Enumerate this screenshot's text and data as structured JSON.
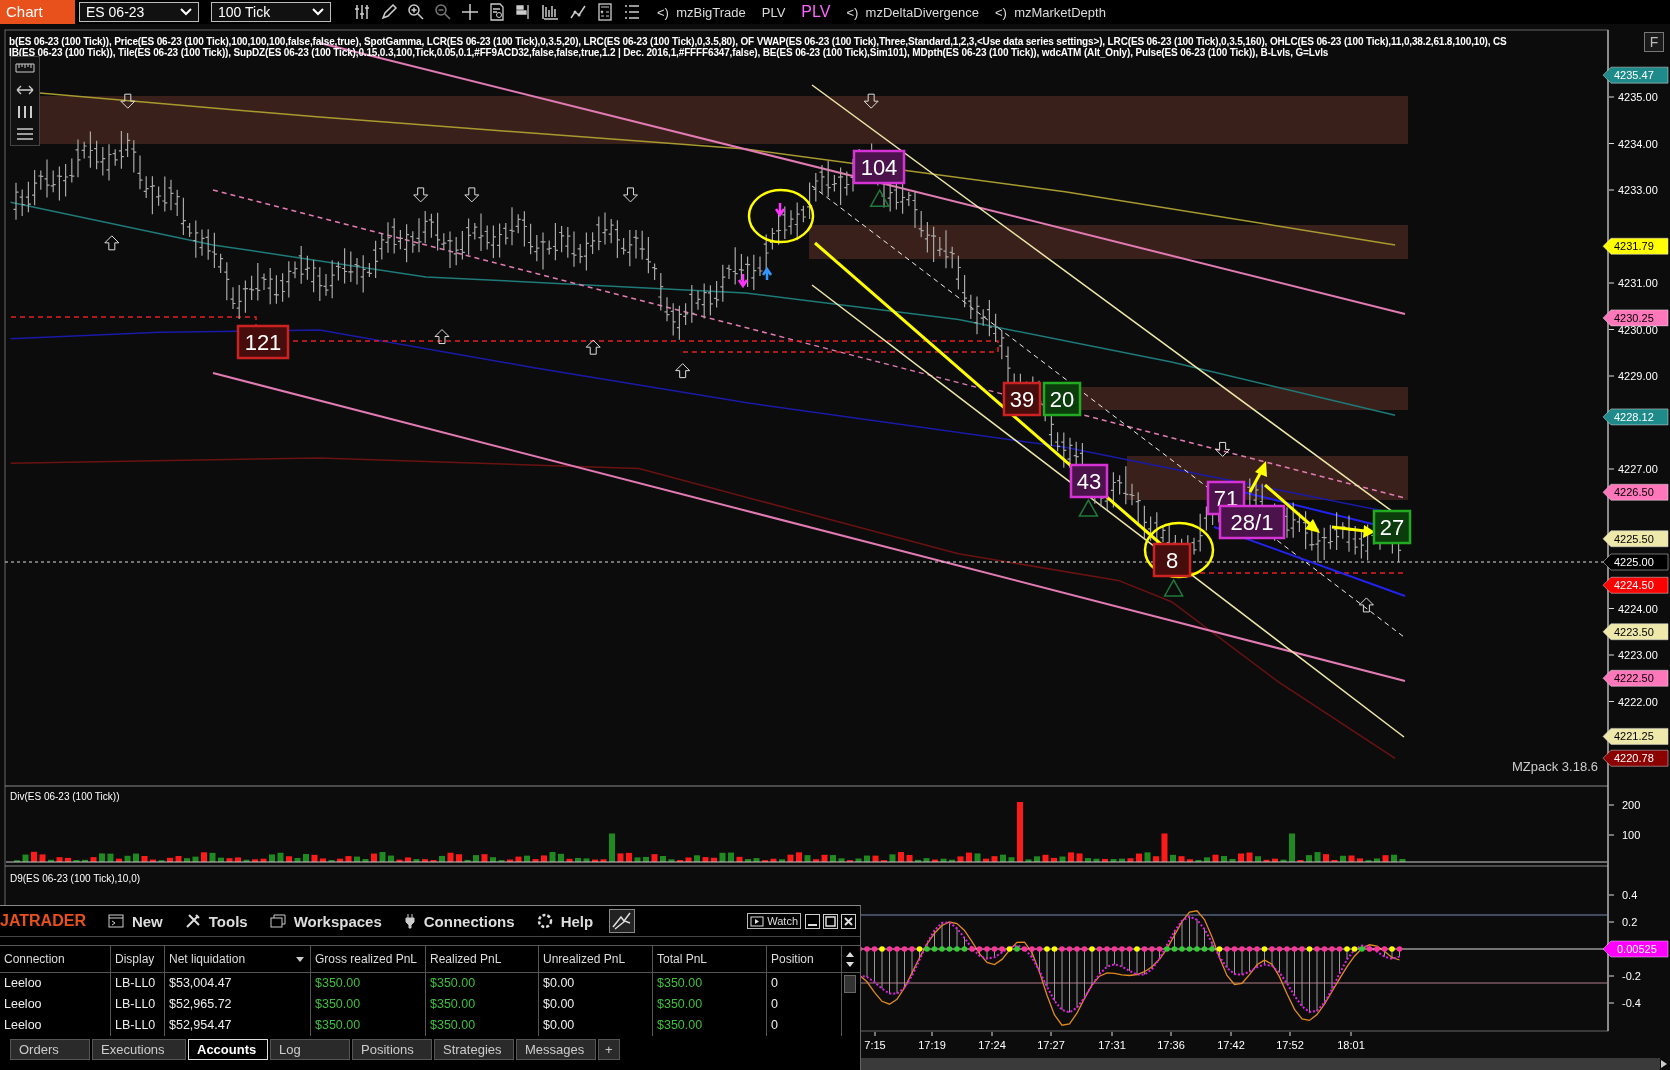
{
  "toolbar": {
    "tab": "Chart",
    "instrument": "ES 06-23",
    "interval": "100 Tick",
    "toggles": [
      {
        "label": "<)  mzBigTrade",
        "active": false
      },
      {
        "label": "PLV",
        "active": false
      },
      {
        "label": "PLV",
        "active": true
      },
      {
        "label": "<)  mzDeltaDivergence",
        "active": false
      },
      {
        "label": "<)  mzMarketDepth",
        "active": false
      }
    ]
  },
  "chart": {
    "legend": [
      "b(ES 06-23 (100 Tick)), Price(ES 06-23 (100 Tick),100,100,100,false,false,true), SpotGamma, LCR(ES 06-23 (100 Tick),0,3.5,20), LRC(ES 06-23 (100 Tick),0,3.5,80), OF VWAP(ES 06-23 (100 Tick),Three,Standard,1,2,3,<Use data series settings>), LRC(ES 06-23 (100 Tick),0,3.5,160), OHLC(ES 06-23 (100 Tick),11,0,38.2,61.8,100,10), CS",
      "IB(ES 06-23 (100 Tick)), Tile(ES 06-23 (100 Tick)), SupDZ(ES 06-23 (100 Tick),0.15,0.3,100,Tick,0.05,0.1,#FF9ACD32,false,false,true,1.2 | Dec. 2016,1,#FFFF6347,false), BE(ES 06-23 (100 Tick),Sim101), MDpth(ES 06-23 (100 Tick)), wdcATM (Alt_Only), Pulse(ES 06-23 (100 Tick)), B-Lvls, G=Lvls"
    ],
    "f_button": "F",
    "version": "MZpack 3.18.6",
    "box_labels": [
      {
        "text": "121",
        "color": "#cc2222"
      },
      {
        "text": "104",
        "color": "#d633d6"
      },
      {
        "text": "39",
        "color": "#cc2222"
      },
      {
        "text": "20",
        "color": "#22aa22"
      },
      {
        "text": "43",
        "color": "#d633d6"
      },
      {
        "text": "71",
        "color": "#d633d6"
      },
      {
        "text": "28/1",
        "color": "#d633d6"
      },
      {
        "text": "8",
        "color": "#cc2222"
      },
      {
        "text": "27",
        "color": "#22aa22"
      }
    ],
    "price_ticks": [
      "4235.00",
      "4234.00",
      "4233.00",
      "4231.00",
      "4230.00",
      "4229.00",
      "4227.00",
      "4224.00",
      "4223.00",
      "4222.00"
    ],
    "price_flags": [
      {
        "text": "4235.47",
        "color": "#1f8a8a"
      },
      {
        "text": "4231.79",
        "color": "#ffff00"
      },
      {
        "text": "4230.25",
        "color": "#ff77bb"
      },
      {
        "text": "4228.12",
        "color": "#1f8a8a"
      },
      {
        "text": "4226.50",
        "color": "#ff77bb"
      },
      {
        "text": "4225.50",
        "color": "#eee8aa"
      },
      {
        "text": "4225.00",
        "color": "#000000"
      },
      {
        "text": "4224.50",
        "color": "#ff0000"
      },
      {
        "text": "4223.50",
        "color": "#eee8aa"
      },
      {
        "text": "4222.50",
        "color": "#ff77bb"
      },
      {
        "text": "4221.25",
        "color": "#eee8aa"
      },
      {
        "text": "4220.78",
        "color": "#8b0000"
      }
    ]
  },
  "div_panel": {
    "title": "Div(ES 06-23 (100 Tick))",
    "ticks": [
      "200",
      "100"
    ]
  },
  "d9_panel": {
    "title": "D9(ES 06-23 (100 Tick),10,0)",
    "ticks": [
      "0.4",
      "0.2",
      "-0.2",
      "-0.4"
    ],
    "flag": {
      "text": "0.00525",
      "color": "#ff00ff"
    }
  },
  "time_axis": [
    "7:15",
    "17:19",
    "17:24",
    "17:27",
    "17:31",
    "17:36",
    "17:42",
    "17:52",
    "18:01"
  ],
  "control_center": {
    "brand": "JATRADER",
    "menu": [
      "New",
      "Tools",
      "Workspaces",
      "Connections",
      "Help"
    ],
    "watch": "Watch",
    "columns": [
      {
        "label": "Connection",
        "kind": "text"
      },
      {
        "label": "Display",
        "kind": "text"
      },
      {
        "label": "Net liquidation",
        "kind": "text"
      },
      {
        "label": "Gross realized PnL",
        "kind": "gain"
      },
      {
        "label": "Realized PnL",
        "kind": "gain"
      },
      {
        "label": "Unrealized PnL",
        "kind": "text"
      },
      {
        "label": "Total PnL",
        "kind": "gain"
      },
      {
        "label": "Position",
        "kind": "text"
      }
    ],
    "rows": [
      [
        "Leeloo",
        "LB-LL0",
        "$53,004.47",
        "$350.00",
        "$350.00",
        "$0.00",
        "$350.00",
        "0"
      ],
      [
        "Leeloo",
        "LB-LL0",
        "$52,965.72",
        "$350.00",
        "$350.00",
        "$0.00",
        "$350.00",
        "0"
      ],
      [
        "Leeloo",
        "LB-LL0",
        "$52,954.47",
        "$350.00",
        "$350.00",
        "$0.00",
        "$350.00",
        "0"
      ]
    ],
    "tabs": [
      {
        "label": "Orders",
        "selected": false
      },
      {
        "label": "Executions",
        "selected": false
      },
      {
        "label": "Accounts",
        "selected": true
      },
      {
        "label": "Log",
        "selected": false
      },
      {
        "label": "Positions",
        "selected": false
      },
      {
        "label": "Strategies",
        "selected": false
      },
      {
        "label": "Messages",
        "selected": false
      }
    ],
    "add_tab": "+"
  }
}
